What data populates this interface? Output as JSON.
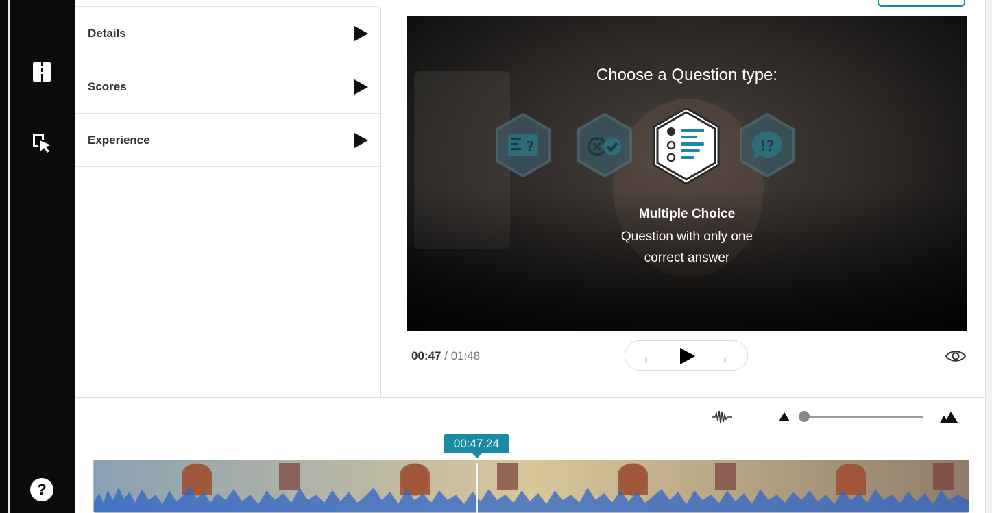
{
  "sidebar": {
    "items": [
      {
        "name": "book-icon"
      },
      {
        "name": "cursor-select-icon"
      }
    ],
    "help_label": "?"
  },
  "panel": {
    "sections": [
      {
        "label": "Details"
      },
      {
        "label": "Scores"
      },
      {
        "label": "Experience"
      }
    ]
  },
  "video": {
    "heading": "Choose a Question type:",
    "question_types": [
      {
        "icon": "open-question-icon",
        "glyph": "≡?"
      },
      {
        "icon": "true-false-icon",
        "glyph": "⊗✓"
      },
      {
        "icon": "multiple-choice-icon",
        "selected": true
      },
      {
        "icon": "reflection-icon",
        "glyph": "!?"
      }
    ],
    "selected_name": "Multiple Choice",
    "selected_desc_line1": "Question with only one",
    "selected_desc_line2": "correct answer"
  },
  "player": {
    "current_time": "00:47",
    "separator": "/",
    "total_time": "01:48",
    "prev_label": "←",
    "next_label": "→"
  },
  "timeline": {
    "playhead_time": "00:47.24",
    "zoom_level": 0.0
  },
  "colors": {
    "accent": "#1a8ba3",
    "rail": "#0b0b0b",
    "waveform": "#2f66c9"
  }
}
